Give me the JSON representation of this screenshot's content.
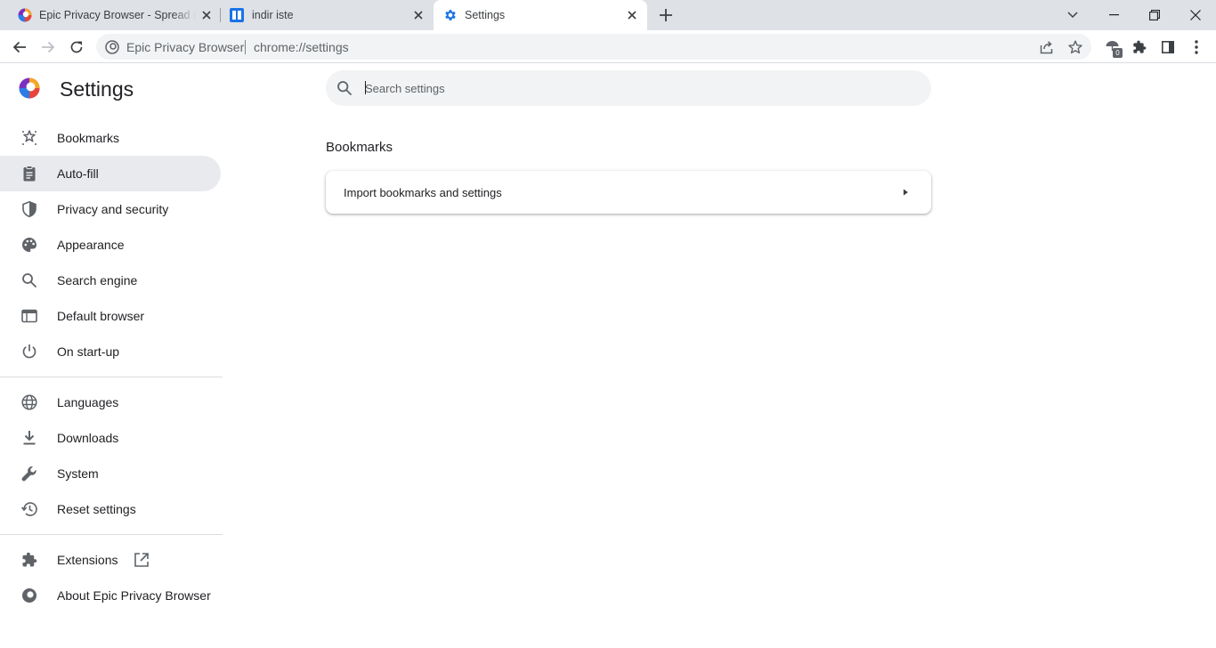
{
  "tabs": [
    {
      "title": "Epic Privacy Browser - Spread Epic",
      "icon": "epic-logo-icon",
      "active": false
    },
    {
      "title": "indir iste",
      "icon": "grid-site-icon",
      "active": false
    },
    {
      "title": "Settings",
      "icon": "gear-icon",
      "active": true
    }
  ],
  "omnibox": {
    "site_name": "Epic Privacy Browser",
    "url": "chrome://settings",
    "extension_badge": "0"
  },
  "page": {
    "title": "Settings",
    "search_placeholder": "Search settings"
  },
  "nav": {
    "items": [
      {
        "label": "Bookmarks",
        "icon": "bookmarks-star-icon"
      },
      {
        "label": "Auto-fill",
        "icon": "clipboard-icon",
        "selected": true
      },
      {
        "label": "Privacy and security",
        "icon": "shield-icon"
      },
      {
        "label": "Appearance",
        "icon": "palette-icon"
      },
      {
        "label": "Search engine",
        "icon": "search-icon"
      },
      {
        "label": "Default browser",
        "icon": "browser-window-icon"
      },
      {
        "label": "On start-up",
        "icon": "power-icon"
      }
    ],
    "advanced_items": [
      {
        "label": "Languages",
        "icon": "globe-icon"
      },
      {
        "label": "Downloads",
        "icon": "download-icon"
      },
      {
        "label": "System",
        "icon": "wrench-icon"
      },
      {
        "label": "Reset settings",
        "icon": "history-icon"
      }
    ],
    "footer_items": [
      {
        "label": "Extensions",
        "icon": "puzzle-icon"
      },
      {
        "label": "About Epic Privacy Browser",
        "icon": "epic-logo-icon"
      }
    ]
  },
  "section": {
    "title": "Bookmarks",
    "card_label": "Import bookmarks and settings"
  },
  "colors": {
    "accent": "#1a73e8",
    "tabstrip_bg": "#dee1e6",
    "selected_nav_bg": "#e8eaed",
    "icon": "#5f6368"
  }
}
